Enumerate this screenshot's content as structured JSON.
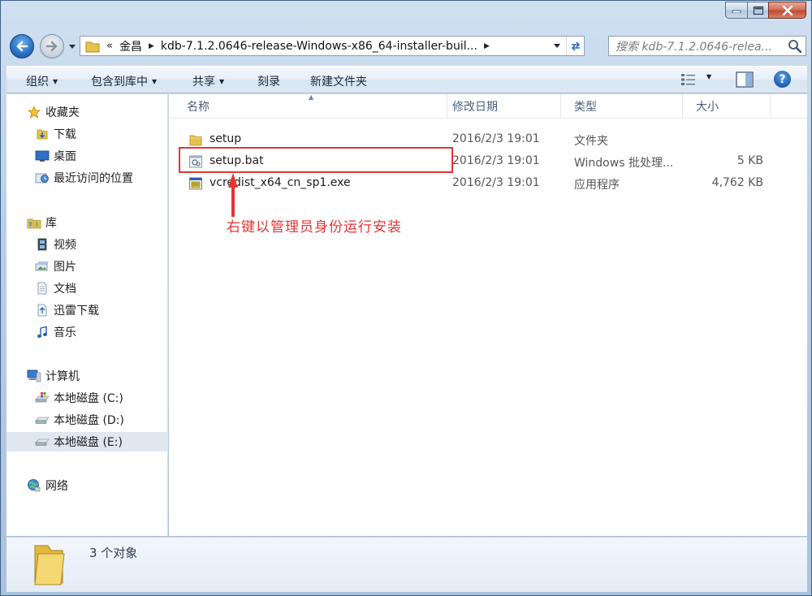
{
  "window": {
    "caption_buttons": [
      "minimize",
      "maximize",
      "close"
    ]
  },
  "address_bar": {
    "overflow": "«",
    "crumbs": [
      "金昌",
      "kdb-7.1.2.0646-release-Windows-x86_64-installer-buil..."
    ]
  },
  "search": {
    "placeholder": "搜索 kdb-7.1.2.0646-relea..."
  },
  "toolbar": {
    "organize": "组织",
    "include_in_library": "包含到库中",
    "share": "共享",
    "burn": "刻录",
    "new_folder": "新建文件夹",
    "help": "?"
  },
  "nav_pane": {
    "favorites": {
      "label": "收藏夹",
      "items": [
        {
          "label": "下载",
          "icon": "download-folder-icon"
        },
        {
          "label": "桌面",
          "icon": "desktop-icon"
        },
        {
          "label": "最近访问的位置",
          "icon": "recent-places-icon"
        }
      ]
    },
    "libraries": {
      "label": "库",
      "items": [
        {
          "label": "视频",
          "icon": "video-library-icon"
        },
        {
          "label": "图片",
          "icon": "pictures-library-icon"
        },
        {
          "label": "文档",
          "icon": "documents-library-icon"
        },
        {
          "label": "迅雷下载",
          "icon": "xunlei-library-icon"
        },
        {
          "label": "音乐",
          "icon": "music-library-icon"
        }
      ]
    },
    "computer": {
      "label": "计算机",
      "items": [
        {
          "label": "本地磁盘 (C:)",
          "icon": "system-drive-icon"
        },
        {
          "label": "本地磁盘 (D:)",
          "icon": "drive-icon"
        },
        {
          "label": "本地磁盘 (E:)",
          "icon": "drive-icon",
          "selected": true
        }
      ]
    },
    "network": {
      "label": "网络"
    }
  },
  "file_list": {
    "columns": [
      "名称",
      "修改日期",
      "类型",
      "大小"
    ],
    "rows": [
      {
        "name": "setup",
        "date": "2016/2/3 19:01",
        "type": "文件夹",
        "size": "",
        "icon": "folder-icon"
      },
      {
        "name": "setup.bat",
        "date": "2016/2/3 19:01",
        "type": "Windows 批处理...",
        "size": "5 KB",
        "icon": "batch-file-icon"
      },
      {
        "name": "vcredist_x64_cn_sp1.exe",
        "date": "2016/2/3 19:01",
        "type": "应用程序",
        "size": "4,762 KB",
        "icon": "exe-file-icon"
      }
    ]
  },
  "annotation": {
    "text": "右键以管理员身份运行安装",
    "color": "#e53434"
  },
  "details": {
    "count_text": "3 个对象"
  }
}
